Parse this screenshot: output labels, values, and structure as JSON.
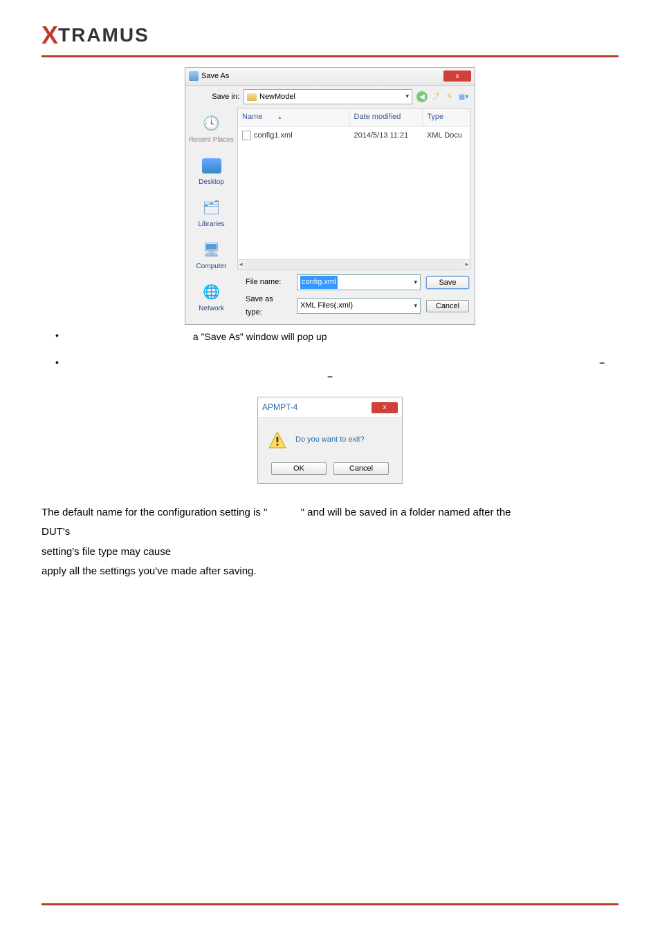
{
  "logo": {
    "x": "X",
    "rest": "TRAMUS"
  },
  "saveas": {
    "title": "Save As",
    "close_x": "x",
    "savein_label": "Save in:",
    "savein_folder": "NewModel",
    "columns": {
      "name": "Name",
      "date": "Date modified",
      "type": "Type"
    },
    "files": [
      {
        "name": "config1.xml",
        "date": "2014/5/13 11:21",
        "type": "XML Docu"
      }
    ],
    "scroll_left": "◂",
    "scroll_right": "▸",
    "filename_label": "File name:",
    "filename_value": "config.xml",
    "saveastype_label": "Save as type:",
    "saveastype_value": "XML Files(.xml)",
    "save_btn": "Save",
    "cancel_btn": "Cancel"
  },
  "sidebar": {
    "recent": "Recent Places",
    "desktop": "Desktop",
    "libraries": "Libraries",
    "computer": "Computer",
    "network": "Network"
  },
  "bullets": {
    "save_text": "a \"Save As\" window will pop up",
    "dash": "–",
    "minus": "–"
  },
  "apmpt": {
    "title": "APMPT-4",
    "close_x": "x",
    "message": "Do you want to exit?",
    "ok": "OK",
    "cancel": "Cancel"
  },
  "para": {
    "line1a": "The default name for the configuration setting is \" ",
    "line1b": " \" and will be saved in a folder named after the",
    "line2": "DUT's",
    "line3": "setting's file type may cause",
    "line4": "apply all the settings you've made after saving."
  }
}
